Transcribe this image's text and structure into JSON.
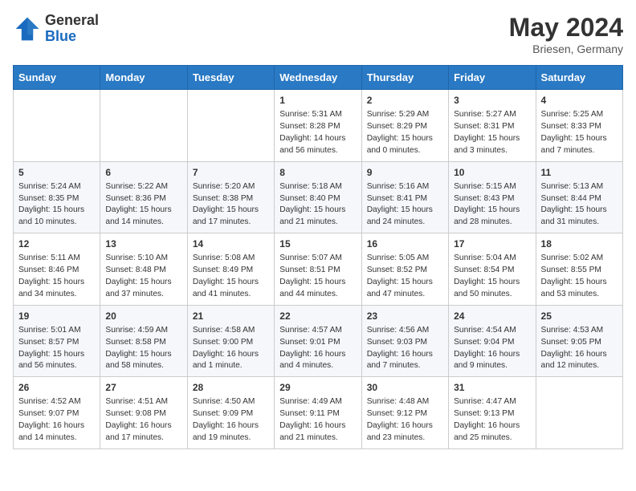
{
  "header": {
    "logo_general": "General",
    "logo_blue": "Blue",
    "month": "May 2024",
    "location": "Briesen, Germany"
  },
  "days_of_week": [
    "Sunday",
    "Monday",
    "Tuesday",
    "Wednesday",
    "Thursday",
    "Friday",
    "Saturday"
  ],
  "weeks": [
    [
      {
        "day": "",
        "info": ""
      },
      {
        "day": "",
        "info": ""
      },
      {
        "day": "",
        "info": ""
      },
      {
        "day": "1",
        "info": "Sunrise: 5:31 AM\nSunset: 8:28 PM\nDaylight: 14 hours and 56 minutes."
      },
      {
        "day": "2",
        "info": "Sunrise: 5:29 AM\nSunset: 8:29 PM\nDaylight: 15 hours and 0 minutes."
      },
      {
        "day": "3",
        "info": "Sunrise: 5:27 AM\nSunset: 8:31 PM\nDaylight: 15 hours and 3 minutes."
      },
      {
        "day": "4",
        "info": "Sunrise: 5:25 AM\nSunset: 8:33 PM\nDaylight: 15 hours and 7 minutes."
      }
    ],
    [
      {
        "day": "5",
        "info": "Sunrise: 5:24 AM\nSunset: 8:35 PM\nDaylight: 15 hours and 10 minutes."
      },
      {
        "day": "6",
        "info": "Sunrise: 5:22 AM\nSunset: 8:36 PM\nDaylight: 15 hours and 14 minutes."
      },
      {
        "day": "7",
        "info": "Sunrise: 5:20 AM\nSunset: 8:38 PM\nDaylight: 15 hours and 17 minutes."
      },
      {
        "day": "8",
        "info": "Sunrise: 5:18 AM\nSunset: 8:40 PM\nDaylight: 15 hours and 21 minutes."
      },
      {
        "day": "9",
        "info": "Sunrise: 5:16 AM\nSunset: 8:41 PM\nDaylight: 15 hours and 24 minutes."
      },
      {
        "day": "10",
        "info": "Sunrise: 5:15 AM\nSunset: 8:43 PM\nDaylight: 15 hours and 28 minutes."
      },
      {
        "day": "11",
        "info": "Sunrise: 5:13 AM\nSunset: 8:44 PM\nDaylight: 15 hours and 31 minutes."
      }
    ],
    [
      {
        "day": "12",
        "info": "Sunrise: 5:11 AM\nSunset: 8:46 PM\nDaylight: 15 hours and 34 minutes."
      },
      {
        "day": "13",
        "info": "Sunrise: 5:10 AM\nSunset: 8:48 PM\nDaylight: 15 hours and 37 minutes."
      },
      {
        "day": "14",
        "info": "Sunrise: 5:08 AM\nSunset: 8:49 PM\nDaylight: 15 hours and 41 minutes."
      },
      {
        "day": "15",
        "info": "Sunrise: 5:07 AM\nSunset: 8:51 PM\nDaylight: 15 hours and 44 minutes."
      },
      {
        "day": "16",
        "info": "Sunrise: 5:05 AM\nSunset: 8:52 PM\nDaylight: 15 hours and 47 minutes."
      },
      {
        "day": "17",
        "info": "Sunrise: 5:04 AM\nSunset: 8:54 PM\nDaylight: 15 hours and 50 minutes."
      },
      {
        "day": "18",
        "info": "Sunrise: 5:02 AM\nSunset: 8:55 PM\nDaylight: 15 hours and 53 minutes."
      }
    ],
    [
      {
        "day": "19",
        "info": "Sunrise: 5:01 AM\nSunset: 8:57 PM\nDaylight: 15 hours and 56 minutes."
      },
      {
        "day": "20",
        "info": "Sunrise: 4:59 AM\nSunset: 8:58 PM\nDaylight: 15 hours and 58 minutes."
      },
      {
        "day": "21",
        "info": "Sunrise: 4:58 AM\nSunset: 9:00 PM\nDaylight: 16 hours and 1 minute."
      },
      {
        "day": "22",
        "info": "Sunrise: 4:57 AM\nSunset: 9:01 PM\nDaylight: 16 hours and 4 minutes."
      },
      {
        "day": "23",
        "info": "Sunrise: 4:56 AM\nSunset: 9:03 PM\nDaylight: 16 hours and 7 minutes."
      },
      {
        "day": "24",
        "info": "Sunrise: 4:54 AM\nSunset: 9:04 PM\nDaylight: 16 hours and 9 minutes."
      },
      {
        "day": "25",
        "info": "Sunrise: 4:53 AM\nSunset: 9:05 PM\nDaylight: 16 hours and 12 minutes."
      }
    ],
    [
      {
        "day": "26",
        "info": "Sunrise: 4:52 AM\nSunset: 9:07 PM\nDaylight: 16 hours and 14 minutes."
      },
      {
        "day": "27",
        "info": "Sunrise: 4:51 AM\nSunset: 9:08 PM\nDaylight: 16 hours and 17 minutes."
      },
      {
        "day": "28",
        "info": "Sunrise: 4:50 AM\nSunset: 9:09 PM\nDaylight: 16 hours and 19 minutes."
      },
      {
        "day": "29",
        "info": "Sunrise: 4:49 AM\nSunset: 9:11 PM\nDaylight: 16 hours and 21 minutes."
      },
      {
        "day": "30",
        "info": "Sunrise: 4:48 AM\nSunset: 9:12 PM\nDaylight: 16 hours and 23 minutes."
      },
      {
        "day": "31",
        "info": "Sunrise: 4:47 AM\nSunset: 9:13 PM\nDaylight: 16 hours and 25 minutes."
      },
      {
        "day": "",
        "info": ""
      }
    ]
  ]
}
